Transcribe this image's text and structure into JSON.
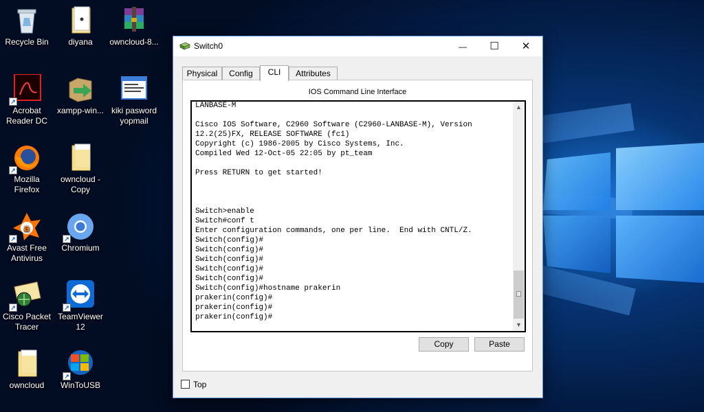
{
  "desktop": {
    "icons": [
      {
        "id": "recycle-bin",
        "label": "Recycle Bin",
        "icon": "recycle-bin-icon",
        "shortcut": false
      },
      {
        "id": "diyana",
        "label": "diyana",
        "icon": "document-icon",
        "shortcut": false
      },
      {
        "id": "owncloud-installer",
        "label": "owncloud-8...",
        "icon": "winrar-archive-icon",
        "shortcut": false
      },
      {
        "id": "acrobat",
        "label": "Acrobat\nReader DC",
        "icon": "acrobat-icon",
        "shortcut": true
      },
      {
        "id": "xampp",
        "label": "xampp-win...",
        "icon": "xampp-installer-icon",
        "shortcut": false
      },
      {
        "id": "kiki",
        "label": "kiki pasword\nyopmail",
        "icon": "text-document-icon",
        "shortcut": false
      },
      {
        "id": "firefox",
        "label": "Mozilla\nFirefox",
        "icon": "firefox-icon",
        "shortcut": true
      },
      {
        "id": "owncloud-copy",
        "label": "owncloud -\nCopy",
        "icon": "folder-icon",
        "shortcut": false
      },
      {
        "id": "avast",
        "label": "Avast Free\nAntivirus",
        "icon": "avast-icon",
        "shortcut": true
      },
      {
        "id": "chromium",
        "label": "Chromium",
        "icon": "chromium-icon",
        "shortcut": true
      },
      {
        "id": "packet-tracer",
        "label": "Cisco Packet\nTracer",
        "icon": "packet-tracer-icon",
        "shortcut": true
      },
      {
        "id": "teamviewer",
        "label": "TeamViewer\n12",
        "icon": "teamviewer-icon",
        "shortcut": true
      },
      {
        "id": "owncloud",
        "label": "owncloud",
        "icon": "folder-icon",
        "shortcut": false
      },
      {
        "id": "wintousb",
        "label": "WinToUSB",
        "icon": "wintousb-icon",
        "shortcut": true
      }
    ]
  },
  "window": {
    "title": "Switch0",
    "controls": {
      "minimize": "—",
      "maximize": "☐",
      "close": "✕"
    },
    "tabs": [
      {
        "label": "Physical",
        "active": false
      },
      {
        "label": "Config",
        "active": false
      },
      {
        "label": "CLI",
        "active": true
      },
      {
        "label": "Attributes",
        "active": false
      }
    ],
    "panel_title": "IOS Command Line Interface",
    "cli_lines": [
      "LANBASE-M",
      "",
      "Cisco IOS Software, C2960 Software (C2960-LANBASE-M), Version",
      "12.2(25)FX, RELEASE SOFTWARE (fc1)",
      "Copyright (c) 1986-2005 by Cisco Systems, Inc.",
      "Compiled Wed 12-Oct-05 22:05 by pt_team",
      "",
      "Press RETURN to get started!",
      "",
      "",
      "",
      "Switch>enable",
      "Switch#conf t",
      "Enter configuration commands, one per line.  End with CNTL/Z.",
      "Switch(config)#",
      "Switch(config)#",
      "Switch(config)#",
      "Switch(config)#",
      "Switch(config)#",
      "Switch(config)#hostname prakerin",
      "prakerin(config)#",
      "prakerin(config)#",
      "prakerin(config)#"
    ],
    "copy_label": "Copy",
    "paste_label": "Paste",
    "top_label": "Top",
    "top_checked": false
  },
  "colors": {
    "window_border": "#5f8ed8",
    "wallpaper_accent": "#1e90ff"
  }
}
